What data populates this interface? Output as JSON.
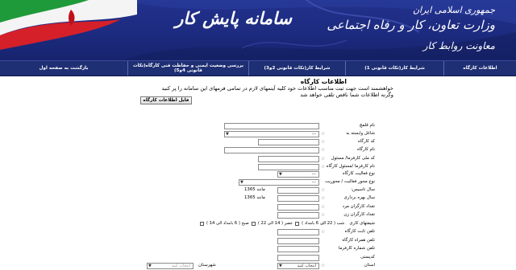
{
  "header": {
    "brand_line1": "جمهوری اسلامی ایران",
    "brand_line2": "وزارت تعاون، کار و رفاه اجتماعی",
    "brand_line3": "معاونت روابط کار",
    "system_title": "سامانه پایش کار",
    "colors": {
      "banner": "#1c2a7e",
      "nav": "#1f2f74",
      "flag_green": "#1f9a3a",
      "flag_red": "#d5202a"
    }
  },
  "nav": {
    "items": [
      "اطلاعات کارگاه",
      "شرایط کار(تکات قانونی 1)",
      "شرایط کار(تکات قانونی 2و3)",
      "بررسی وضعیت ایمنی و حفاظت فنی کارگاه(تکات قانونی 4و5)",
      "بازگشت به صفحه اول"
    ]
  },
  "intro": {
    "title": "اطلاعات کارگاه",
    "line1": "خواهشمند است جهت ثبت مناسب اطلاعات خود کلیه آیتمهای لازم در تمامی فرمهای این سامانه را پر کنید",
    "line2": "وگرنه اطلاعات شما ناقص تلقی خواهد شد"
  },
  "guide_button": "فایل اطلاعات کارگاه",
  "form": {
    "labels": {
      "title": "نام قلمچ",
      "dependency": "شاغل وابسته به",
      "workshop_code": "کد کارگاه",
      "workshop_name": "نام کارگاه",
      "national_id": "کد ملی کارفرما/ مسئول",
      "employer_name": "نام کارفرما /مسئول کارگاه",
      "activity_type": "نوع فعالیت کارگاه",
      "main_activity": "نوع محور فعالیت / محوریت",
      "founding_year": "سال تاسیس:",
      "operation_year": "سال بهره برداری",
      "male_count": "تعداد کارگران مرد",
      "female_count": "تعداد کارگران زن",
      "shifts": "شیفتهای کاری",
      "phone": "تلفن ثابت کارگاه",
      "mobile": "تلفن همراه کارگاه",
      "fax": "تلفن شماره کارفرما",
      "postal_code": "کدپستی",
      "province": "استان",
      "city": "شهرستان"
    },
    "select_default": "---",
    "select_choose": "انتخاب کنید",
    "founding_example": "مانند 1365",
    "operation_example": "مانند 1365",
    "shift_options": [
      "صبح ( 6 بامداد الی 14 )",
      "عصر ( 14 الی 22 )",
      "شب ( 22 الی 6 بامداد )"
    ]
  }
}
